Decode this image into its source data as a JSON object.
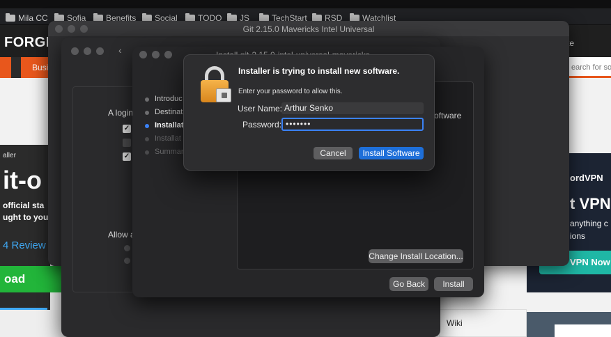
{
  "bookmarks": [
    "Mila CC",
    "Sofia",
    "Benefits",
    "Social",
    "TODO",
    "JS",
    "TechStart",
    "RSD",
    "Watchlist"
  ],
  "website": {
    "logo": "FORGE",
    "nav_left": "Busi",
    "nav_right": "te",
    "search_placeholder": "earch for sof",
    "installer_label": "aller",
    "headline": "it-o",
    "line1": "official sta",
    "line2": "ught to you",
    "reviews": "4 Review",
    "download": "oad",
    "ad_brand": "ordVPN",
    "ad_headline": "t VPN",
    "ad_line1": "anything c",
    "ad_line2": "ions",
    "ad_button": "VPN Now",
    "wiki": "Wiki"
  },
  "installer": {
    "window_title": "Git 2.15.0 Mavericks Intel Universal",
    "inner_title": "Install git-2.15.0-intel-universal-mavericks",
    "steps": [
      "Introduc",
      "Destinat",
      "Installat",
      "Installat",
      "Summar"
    ],
    "login_text": "A login",
    "allow_text": "Allow a",
    "right_text": "oftware",
    "change_location": "Change Install Location...",
    "go_back": "Go Back",
    "install": "Install"
  },
  "auth_dialog": {
    "title": "Installer is trying to install new software.",
    "subtitle": "Enter your password to allow this.",
    "username_label": "User Name:",
    "username_value": "Arthur Senko",
    "password_label": "Password:",
    "password_value": "•••••••",
    "cancel": "Cancel",
    "install_software": "Install Software"
  },
  "colors": {
    "accent_blue": "#1e6fd9",
    "orange": "#e8571c",
    "green": "#22b53a",
    "vpn_teal": "#1fb7a5"
  }
}
